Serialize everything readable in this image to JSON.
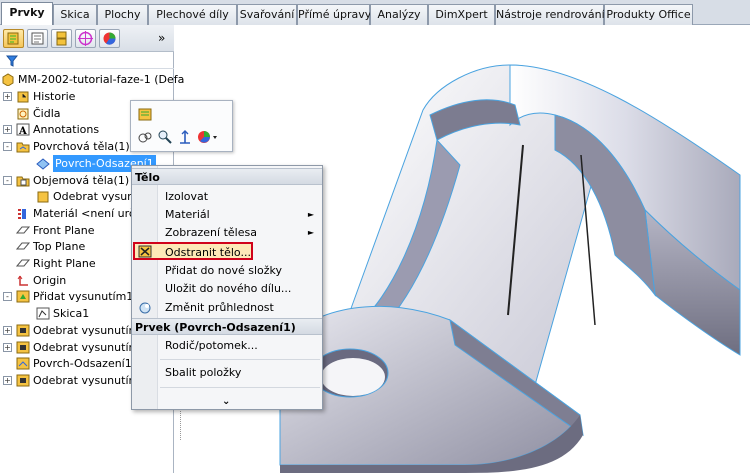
{
  "ribbon": {
    "tabs": [
      "Prvky",
      "Skica",
      "Plochy",
      "Plechové díly",
      "Svařování",
      "Přímé úpravy",
      "Analýzy",
      "DimXpert",
      "Nástroje rendrování",
      "Produkty Office"
    ],
    "active_tab": "Prvky"
  },
  "panel": {
    "toolbar_icons": [
      "feature-manager-icon",
      "property-manager-icon",
      "configuration-manager-icon",
      "dimxpert-manager-icon",
      "display-manager-icon"
    ],
    "more": "»",
    "root": "MM-2002-tutorial-faze-1  (Defa",
    "tree": [
      {
        "label": "Historie",
        "icon": "history-icon"
      },
      {
        "label": "Čidla",
        "icon": "sensor-icon"
      },
      {
        "label": "Annotations",
        "icon": "annotations-icon"
      },
      {
        "label": "Povrchová těla(1)",
        "icon": "surface-bodies-folder-icon"
      },
      {
        "label": "Povrch-Odsazení1",
        "icon": "surface-body-icon"
      },
      {
        "label": "Objemová těla(1)",
        "icon": "solid-bodies-folder-icon"
      },
      {
        "label": "Odebrat vysunut",
        "icon": "solid-body-icon"
      },
      {
        "label": "Materiál <není urče",
        "icon": "material-icon"
      },
      {
        "label": "Front Plane",
        "icon": "plane-icon"
      },
      {
        "label": "Top Plane",
        "icon": "plane-icon"
      },
      {
        "label": "Right Plane",
        "icon": "plane-icon"
      },
      {
        "label": "Origin",
        "icon": "origin-icon"
      },
      {
        "label": "Přidat vysunutím1",
        "icon": "extrude-icon"
      },
      {
        "label": "Skica1",
        "icon": "sketch-icon"
      },
      {
        "label": "Odebrat vysunutím",
        "icon": "cut-extrude-icon"
      },
      {
        "label": "Odebrat vysunutím",
        "icon": "cut-extrude-icon"
      },
      {
        "label": "Povrch-Odsazení1",
        "icon": "offset-surface-icon"
      },
      {
        "label": "Odebrat vysunutím",
        "icon": "cut-extrude-icon"
      }
    ]
  },
  "context_menu": {
    "header_body": "Tělo",
    "items_body": [
      {
        "label": "Izolovat",
        "submenu": false
      },
      {
        "label": "Materiál",
        "submenu": true
      },
      {
        "label": "Zobrazení tělesa",
        "submenu": true
      },
      {
        "label": "Odstranit tělo...",
        "submenu": false,
        "highlighted": true
      },
      {
        "label": "Přidat do nové složky",
        "submenu": false
      },
      {
        "label": "Uložit do nového dílu...",
        "submenu": false
      },
      {
        "label": "Změnit průhlednost",
        "submenu": false
      }
    ],
    "header_feature": "Prvek (Povrch-Odsazení1)",
    "items_feature": [
      {
        "label": "Rodič/potomek..."
      },
      {
        "label": "Sbalit položky"
      }
    ],
    "expand_chevron": "¥"
  },
  "colors": {
    "selection": "#3399ff",
    "highlight_border": "#d0021b",
    "model_edge": "#4aa3e0"
  }
}
